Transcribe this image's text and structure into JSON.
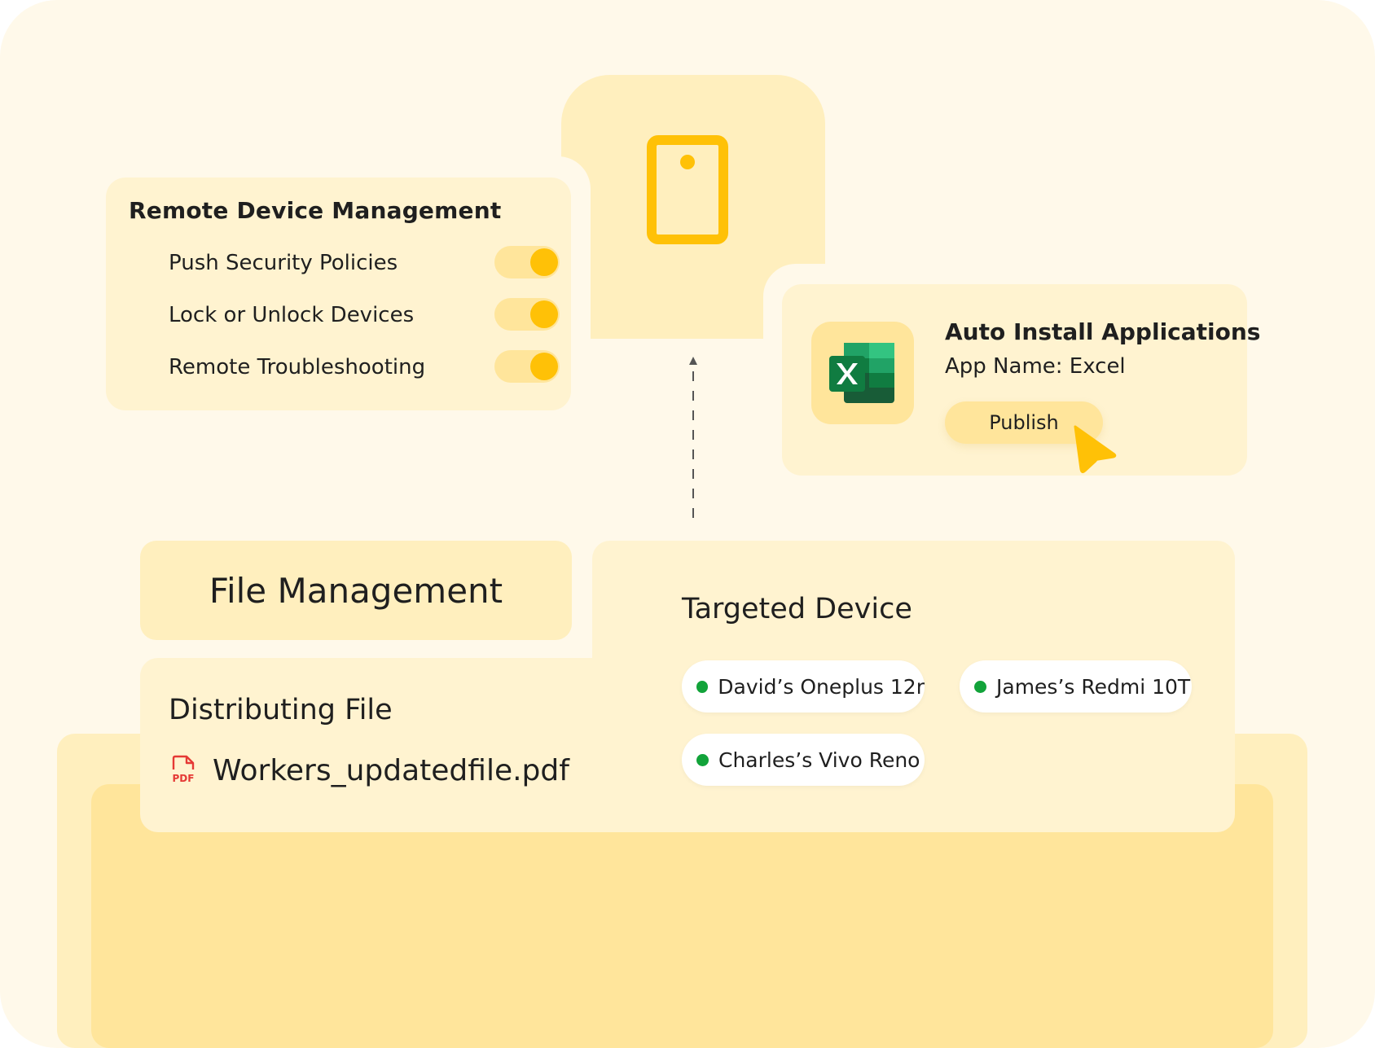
{
  "remote_device_management": {
    "title": "Remote Device Management",
    "items": [
      {
        "label": "Push Security Policies",
        "enabled": true
      },
      {
        "label": "Lock or Unlock Devices",
        "enabled": true
      },
      {
        "label": "Remote Troubleshooting",
        "enabled": true
      }
    ]
  },
  "auto_install": {
    "title": "Auto Install Applications",
    "app_name": "App Name: Excel",
    "publish_label": "Publish",
    "icon": "excel-icon"
  },
  "file_management": {
    "header": "File Management",
    "distributing_title": "Distributing File",
    "file_name": "Workers_updatedfile.pdf",
    "file_icon": "pdf-icon",
    "targeted_title": "Targeted Device",
    "devices": [
      "David’s Oneplus 12r",
      "James’s Redmi 10T",
      "Charles’s Vivo Reno"
    ]
  },
  "colors": {
    "accent": "#ffc107",
    "tile": "#ffefbe",
    "card": "#fff3d0",
    "status_online": "#12a33a"
  }
}
